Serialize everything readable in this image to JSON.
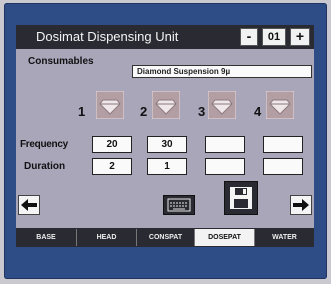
{
  "window": {
    "title": "Dosimat Dispensing Unit"
  },
  "unit": {
    "decrement_label": "-",
    "number": "01",
    "increment_label": "+"
  },
  "consumables": {
    "label": "Consumables",
    "value": "Diamond Suspension 9µ"
  },
  "controllers": [
    {
      "number": "1",
      "frequency": "20",
      "duration": "2"
    },
    {
      "number": "2",
      "frequency": "30",
      "duration": "1"
    },
    {
      "number": "3",
      "frequency": "",
      "duration": ""
    },
    {
      "number": "4",
      "frequency": "",
      "duration": ""
    }
  ],
  "rows": {
    "frequency_label": "Frequency",
    "duration_label": "Duration"
  },
  "tabs": [
    {
      "label": "BASE",
      "active": false
    },
    {
      "label": "HEAD",
      "active": false
    },
    {
      "label": "CONSPAT",
      "active": false
    },
    {
      "label": "DOSEPAT",
      "active": true
    },
    {
      "label": "WATER",
      "active": false
    }
  ],
  "icons": [
    "diamond-icon",
    "left-arrow-icon",
    "right-arrow-icon",
    "keyboard-icon",
    "save-icon"
  ],
  "colors": {
    "bezel": "#2e4d86",
    "screen": "#a9a6ba",
    "titlebar": "#2a2a33",
    "controller": "#b39fa3"
  }
}
